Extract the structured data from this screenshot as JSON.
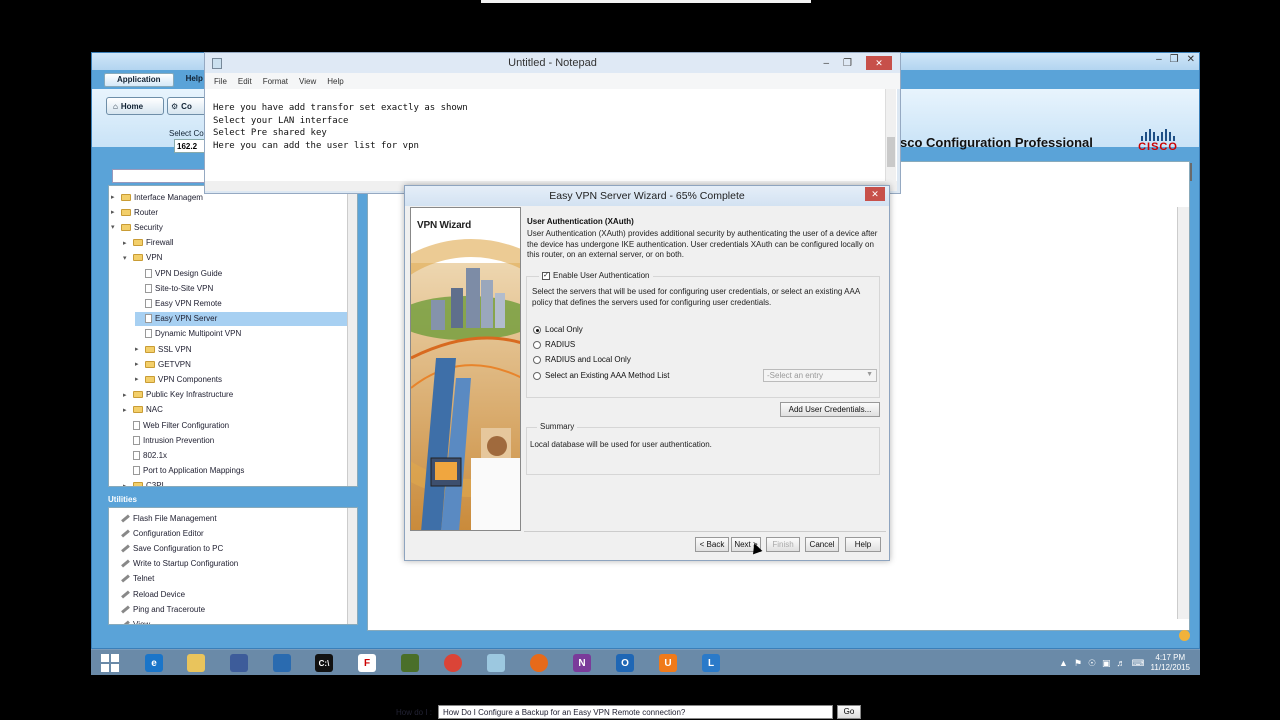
{
  "ccp": {
    "menu": [
      "Application",
      "Help"
    ],
    "home_label": "Home",
    "config_label": "Co",
    "select_label": "Select Co",
    "select_value": "162.2",
    "app_title": "sco Configuration Professional",
    "cisco_word": "CISCO"
  },
  "tree": {
    "items": [
      {
        "label": "Interface Managem",
        "level": 0,
        "twist": "▸",
        "type": "folder"
      },
      {
        "label": "Router",
        "level": 0,
        "twist": "▸",
        "type": "folder"
      },
      {
        "label": "Security",
        "level": 0,
        "twist": "▾",
        "type": "folder"
      },
      {
        "label": "Firewall",
        "level": 1,
        "twist": "▸",
        "type": "folder"
      },
      {
        "label": "VPN",
        "level": 1,
        "twist": "▾",
        "type": "folder"
      },
      {
        "label": "VPN Design Guide",
        "level": 2,
        "twist": "",
        "type": "page"
      },
      {
        "label": "Site-to-Site VPN",
        "level": 2,
        "twist": "",
        "type": "page"
      },
      {
        "label": "Easy VPN Remote",
        "level": 2,
        "twist": "",
        "type": "page"
      },
      {
        "label": "Easy VPN Server",
        "level": 2,
        "twist": "",
        "type": "page",
        "selected": true
      },
      {
        "label": "Dynamic Multipoint VPN",
        "level": 2,
        "twist": "",
        "type": "page"
      },
      {
        "label": "SSL VPN",
        "level": 2,
        "twist": "▸",
        "type": "folder"
      },
      {
        "label": "GETVPN",
        "level": 2,
        "twist": "▸",
        "type": "folder"
      },
      {
        "label": "VPN Components",
        "level": 2,
        "twist": "▸",
        "type": "folder"
      },
      {
        "label": "Public Key Infrastructure",
        "level": 1,
        "twist": "▸",
        "type": "folder"
      },
      {
        "label": "NAC",
        "level": 1,
        "twist": "▸",
        "type": "folder"
      },
      {
        "label": "Web Filter Configuration",
        "level": 1,
        "twist": "",
        "type": "page"
      },
      {
        "label": "Intrusion Prevention",
        "level": 1,
        "twist": "",
        "type": "page"
      },
      {
        "label": "802.1x",
        "level": 1,
        "twist": "",
        "type": "page"
      },
      {
        "label": "Port to Application Mappings",
        "level": 1,
        "twist": "",
        "type": "page"
      },
      {
        "label": "C3PL",
        "level": 1,
        "twist": "▸",
        "type": "folder"
      }
    ]
  },
  "utilities": {
    "label": "Utilities",
    "items": [
      "Flash File Management",
      "Configuration Editor",
      "Save Configuration to PC",
      "Write to Startup Configuration",
      "Telnet",
      "Reload Device",
      "Ping and Traceroute",
      "View"
    ]
  },
  "content": {
    "howdoi_label": "How do I :",
    "howdoi_value": "How Do I Configure a Backup for an Easy VPN Remote connection?",
    "go_label": "Go"
  },
  "notepad": {
    "title": "Untitled - Notepad",
    "menu": [
      "File",
      "Edit",
      "Format",
      "View",
      "Help"
    ],
    "lines": [
      "Here you have add transfor set exactly as shown",
      "Select your LAN interface",
      "Select Pre shared key",
      "",
      "Here you can add the user list for vpn"
    ]
  },
  "wizard": {
    "title": "Easy VPN Server Wizard - 65% Complete",
    "banner_title": "VPN Wizard",
    "heading": "User Authentication (XAuth)",
    "description": "User Authentication (XAuth) provides additional security by authenticating the user of a device after the device has undergone IKE authentication. User credentials XAuth can be configured locally on this router, on an external server, or on both.",
    "enable_label": "Enable User Authentication",
    "group_desc": "Select the servers that will be used for configuring user credentials, or select an existing AAA policy that defines the servers used for configuring user credentials.",
    "options": [
      "Local Only",
      "RADIUS",
      "RADIUS and Local Only",
      "Select an Existing AAA Method List"
    ],
    "aaa_placeholder": "-Select an entry",
    "add_credentials": "Add User Credentials...",
    "summary_label": "Summary",
    "summary_text": "Local database will be used for user authentication.",
    "buttons": {
      "back": "< Back",
      "next": "Next >",
      "finish": "Finish",
      "cancel": "Cancel",
      "help": "Help"
    }
  },
  "clock": {
    "time": "4:17 PM",
    "date": "11/12/2015"
  }
}
